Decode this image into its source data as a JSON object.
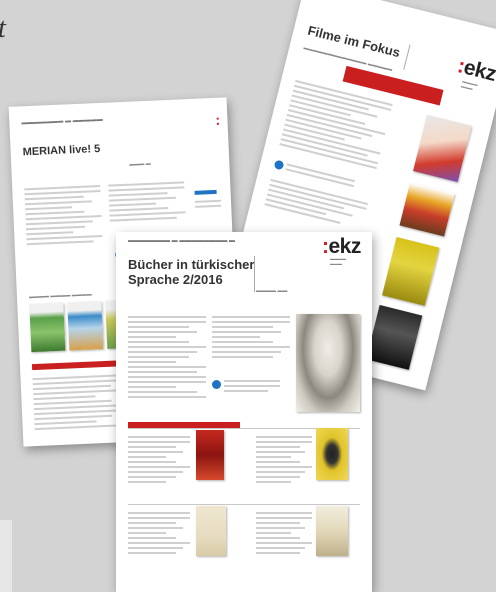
{
  "sheets": {
    "filme": {
      "title": "Filme im Fokus",
      "logo_mark": "ekz",
      "logo_colon": ":"
    },
    "merian": {
      "title": "MERIAN live! 5",
      "logo_colon": ":"
    },
    "buecher": {
      "title_line1": "Bücher in türkischer",
      "title_line2": "Sprache 2/2016",
      "logo_mark": "ekz",
      "logo_colon": ":"
    }
  },
  "colors": {
    "brand_red": "#d41c24",
    "accent_blue": "#1f73c4"
  }
}
